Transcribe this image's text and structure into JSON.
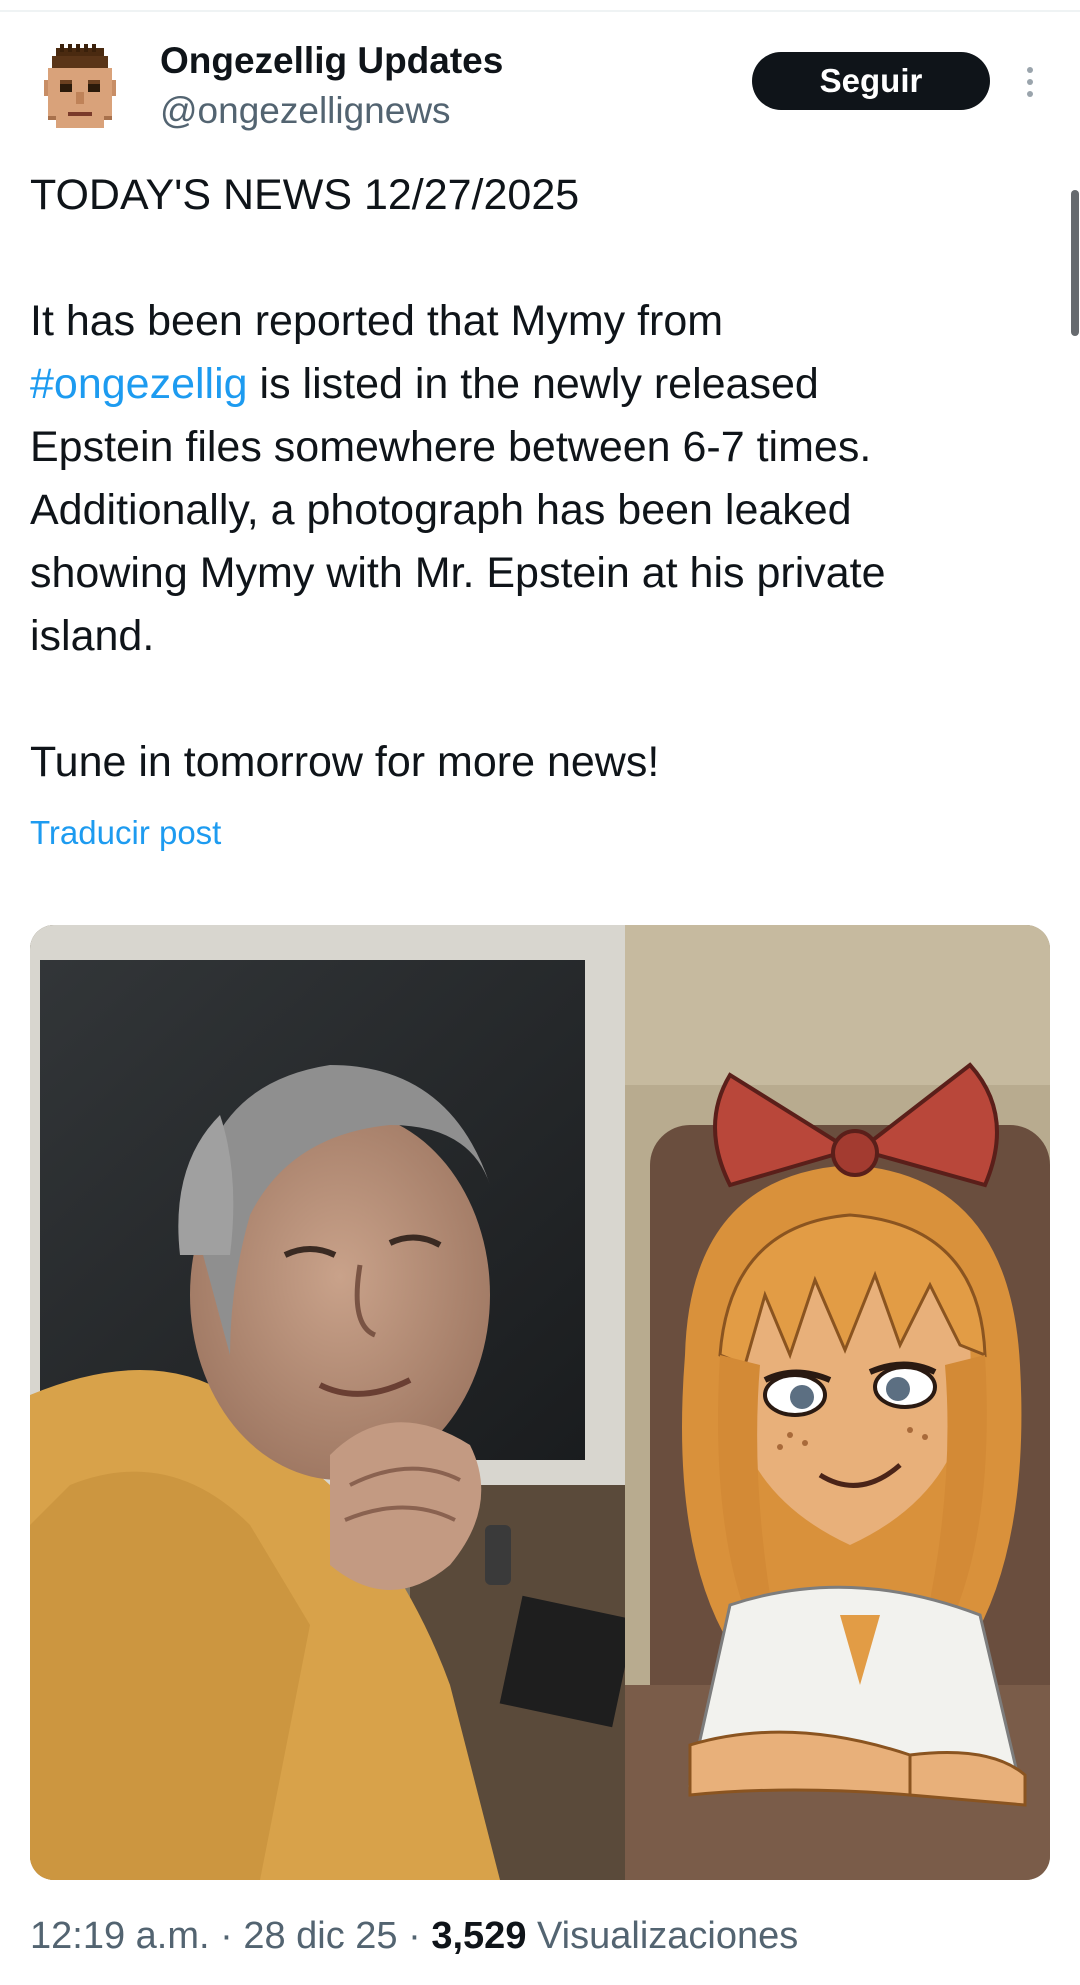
{
  "author": {
    "name": "Ongezellig Updates",
    "handle": "@ongezellignews"
  },
  "follow_label": "Seguir",
  "tweet": {
    "line1": "TODAY'S NEWS 12/27/2025",
    "line2": "It has been reported that Mymy from",
    "hashtag": "#ongezellig",
    "line3_rest": " is listed in the newly released",
    "line4": "Epstein files somewhere between 6-7 times.",
    "line5": "Additionally, a photograph has been leaked",
    "line6": "showing Mymy with Mr. Epstein at his private",
    "line7": "island.",
    "line8": "Tune in tomorrow for more news!"
  },
  "translate_label": "Traducir post",
  "meta": {
    "time": "12:19 a.m.",
    "sep1": " · ",
    "date": "28 dic 25",
    "sep2": " · ",
    "views_count": "3,529",
    "views_label": " Visualizaciones"
  },
  "icons": {
    "more": "more-vertical-icon",
    "avatar": "pixel-face-avatar"
  },
  "colors": {
    "link": "#1d9bf0",
    "text": "#0f1419",
    "secondary": "#536471",
    "follow_bg": "#0f1419"
  }
}
